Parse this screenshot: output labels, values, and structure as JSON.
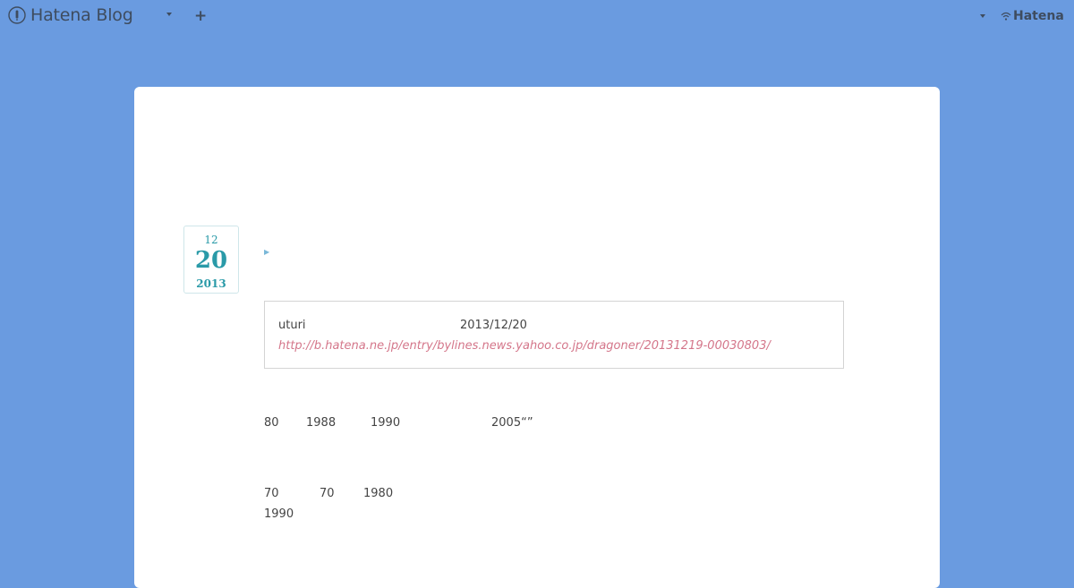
{
  "header": {
    "brand_name": "Hatena Blog",
    "brand_icon": "hatena-blog-pen-icon",
    "add_button": "+",
    "hatena_logo_text": "Hatena",
    "hatena_logo_icon": "hatena-wifi-icon"
  },
  "entry": {
    "date": {
      "month": "12",
      "day": "20",
      "year": "2013"
    },
    "embed": {
      "user": "uturi",
      "date": "2013/12/20",
      "url": "http://b.hatena.ne.jp/entry/bylines.news.yahoo.co.jp/dragoner/20131219-00030803/"
    },
    "paragraph_1": [
      "80",
      "1988",
      "1990",
      "2005“”"
    ],
    "paragraph_2_line_1": [
      "70",
      "70",
      "1980"
    ],
    "paragraph_2_line_2": [
      "1990"
    ]
  },
  "colors": {
    "background": "#6a9be0",
    "card": "#ffffff",
    "date_accent": "#2a9aa8",
    "link": "#d4768a"
  }
}
